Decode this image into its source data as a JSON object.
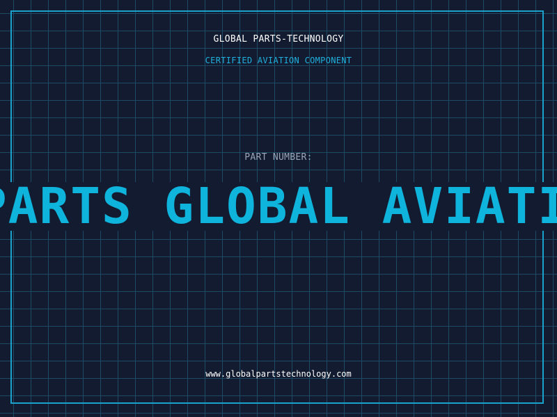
{
  "header": {
    "title": "GLOBAL PARTS-TECHNOLOGY",
    "subtitle": "CERTIFIED AVIATION COMPONENT"
  },
  "part": {
    "label": "PART NUMBER:",
    "banner_text": "AIR PARTS GLOBAL AVIATION"
  },
  "footer": {
    "url": "www.globalpartstechnology.com"
  },
  "colors": {
    "background": "#131b30",
    "grid": "#1f4a63",
    "accent": "#19a3cc",
    "banner_text": "#0fb4dc"
  }
}
